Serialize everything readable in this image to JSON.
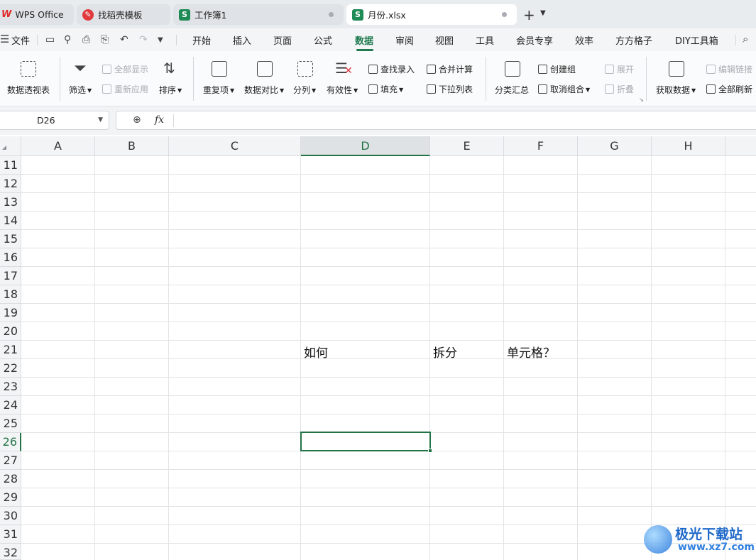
{
  "tabs": [
    {
      "label": "WPS Office",
      "logo": "W"
    },
    {
      "label": "找稻壳模板"
    },
    {
      "label": "工作簿1",
      "badge": "S"
    },
    {
      "label": "月份.xlsx",
      "badge": "S"
    }
  ],
  "menu": {
    "file": "文件",
    "items": [
      "开始",
      "插入",
      "页面",
      "公式",
      "数据",
      "审阅",
      "视图",
      "工具",
      "会员专享",
      "效率",
      "方方格子",
      "DIY工具箱"
    ],
    "active": "数据"
  },
  "ribbon": {
    "pivot": "数据透视表",
    "filter": "筛选",
    "show_all": "全部显示",
    "reapply": "重新应用",
    "sort": "排序",
    "duplicates": "重复项",
    "compare": "数据对比",
    "split": "分列",
    "validity": "有效性",
    "find_enter": "查找录入",
    "fill": "填充",
    "merge_calc": "合并计算",
    "dropdown": "下拉列表",
    "subtotal": "分类汇总",
    "create_group": "创建组",
    "ungroup": "取消组合",
    "expand": "展开",
    "collapse": "折叠",
    "get_data": "获取数据",
    "edit_links": "编辑链接",
    "refresh_all": "全部刷新"
  },
  "formula_bar": {
    "name_box": "D26",
    "fx": "fx",
    "value": ""
  },
  "columns": [
    "A",
    "B",
    "C",
    "D",
    "E",
    "F",
    "G",
    "H"
  ],
  "selected_column": "D",
  "rows": [
    "11",
    "12",
    "13",
    "14",
    "15",
    "16",
    "17",
    "18",
    "19",
    "20",
    "21",
    "22",
    "23",
    "24",
    "25",
    "26",
    "27",
    "28",
    "29",
    "30",
    "31",
    "32"
  ],
  "selected_row": "26",
  "cells": {
    "D21": "如何",
    "E21": "拆分",
    "F21": "单元格？"
  },
  "watermark": {
    "title": "极光下载站",
    "url": "www.xz7.com"
  },
  "colors": {
    "accent": "#217346",
    "menu_active": "#1e7a4e",
    "wps_red": "#e02a2a"
  }
}
